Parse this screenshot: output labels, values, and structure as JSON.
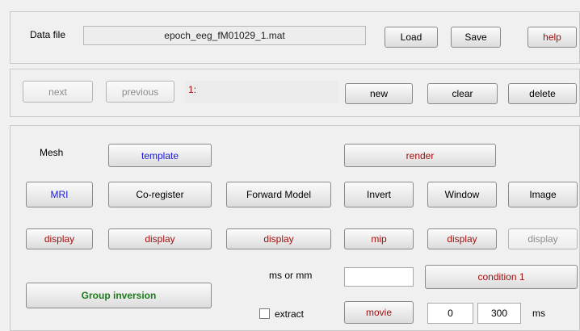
{
  "file_panel": {
    "data_file_label": "Data file",
    "filename": "epoch_eeg_fM01029_1.mat",
    "load": "Load",
    "save": "Save",
    "help": "help"
  },
  "nav_panel": {
    "next": "next",
    "previous": "previous",
    "status": "1:",
    "new": "new",
    "clear": "clear",
    "delete": "delete"
  },
  "main_panel": {
    "mesh_label": "Mesh",
    "template": "template",
    "render": "render",
    "mri": "MRI",
    "coregister": "Co-register",
    "forward_model": "Forward Model",
    "invert": "Invert",
    "window": "Window",
    "image": "Image",
    "display_1": "display",
    "display_2": "display",
    "display_3": "display",
    "mip": "mip",
    "display_4": "display",
    "display_5": "display",
    "ms_or_mm_label": "ms or mm",
    "ms_or_mm_value": "",
    "condition": "condition 1",
    "group_inversion": "Group inversion",
    "extract_label": "extract",
    "extract_checked": false,
    "movie": "movie",
    "movie_start": "0",
    "movie_end": "300",
    "ms_label": "ms"
  },
  "colors": {
    "red_text": "#a01010",
    "blue_text": "#1a1ad8",
    "green_text": "#1d7a1d",
    "disabled_text": "#8c8c8c"
  }
}
